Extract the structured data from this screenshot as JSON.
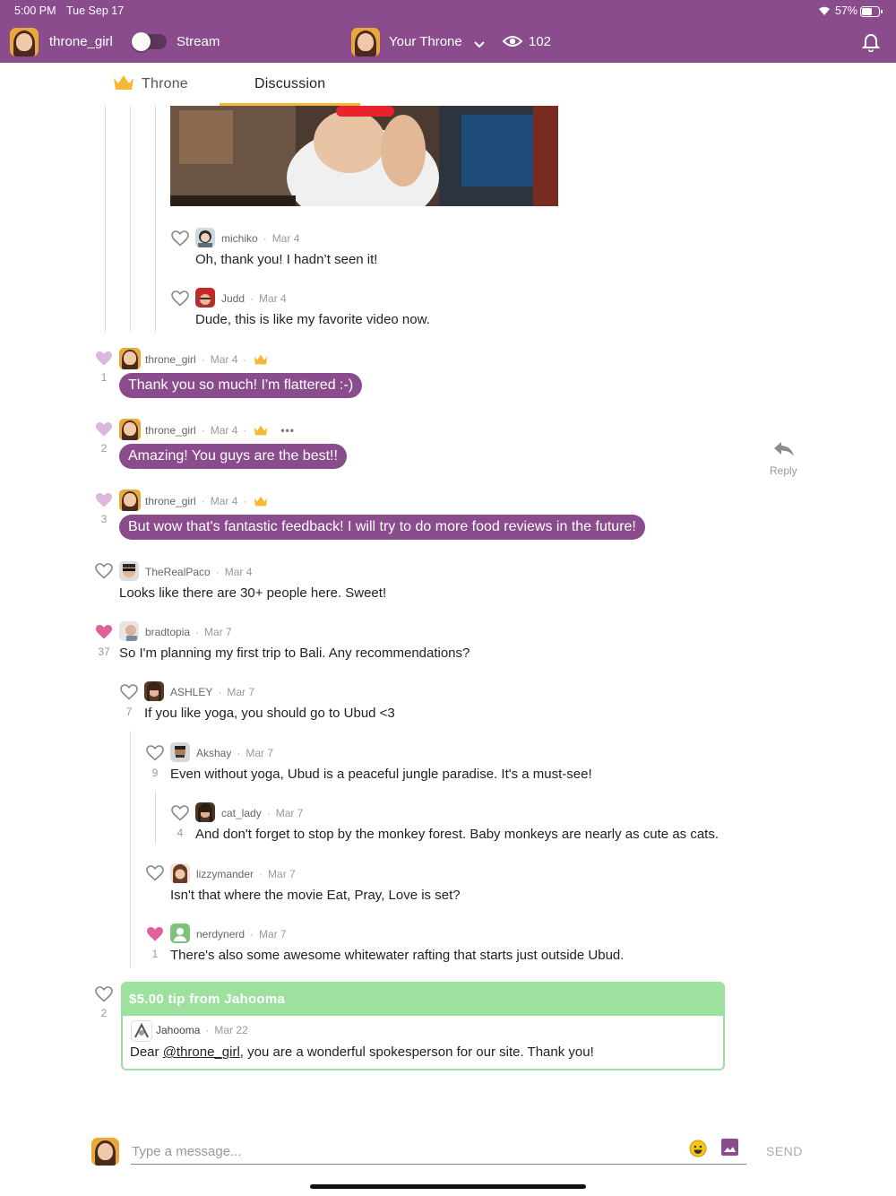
{
  "status_bar": {
    "time": "5:00 PM",
    "date": "Tue Sep 17",
    "battery": "57%"
  },
  "header": {
    "username": "throne_girl",
    "stream_label": "Stream",
    "throne_label": "Your Throne",
    "viewer_count": "102",
    "colors": {
      "bar": "#8a4c8c"
    }
  },
  "tabs": [
    {
      "label": "Throne"
    },
    {
      "label": "Discussion",
      "active": true
    }
  ],
  "comments": [
    {
      "user": "michiko",
      "date": "Mar 4",
      "text": "Oh, thank you! I hadn’t seen it!"
    },
    {
      "user": "Judd",
      "date": "Mar 4",
      "text": "Dude, this is like my favorite video now."
    },
    {
      "user": "throne_girl",
      "date": "Mar 4",
      "text": "Thank you so much! I'm flattered :-)",
      "likes": "1",
      "creator": true
    },
    {
      "user": "throne_girl",
      "date": "Mar 4",
      "text": "Amazing! You guys are the best!!",
      "likes": "2",
      "creator": true
    },
    {
      "user": "throne_girl",
      "date": "Mar 4",
      "text": "But wow that's fantastic feedback! I will try to do more food reviews in the future!",
      "likes": "3",
      "creator": true
    },
    {
      "user": "TheRealPaco",
      "date": "Mar 4",
      "text": "Looks like there are 30+ people here. Sweet!"
    },
    {
      "user": "bradtopia",
      "date": "Mar 7",
      "text": "So I'm planning my first trip to Bali. Any recommendations?",
      "likes": "37",
      "liked": true
    },
    {
      "user": "ASHLEY",
      "date": "Mar 7",
      "text": "If you like yoga, you should go to Ubud <3",
      "likes": "7"
    },
    {
      "user": "Akshay",
      "date": "Mar 7",
      "text": "Even without yoga, Ubud is a peaceful jungle paradise. It's a must-see!",
      "likes": "9"
    },
    {
      "user": "cat_lady",
      "date": "Mar 7",
      "text": "And don't forget to stop by the monkey forest. Baby monkeys are nearly as cute as cats.",
      "likes": "4"
    },
    {
      "user": "lizzymander",
      "date": "Mar 7",
      "text": "Isn't that where the movie Eat, Pray, Love is set?"
    },
    {
      "user": "nerdynerd",
      "date": "Mar 7",
      "text": "There's also some awesome whitewater rafting that starts just outside Ubud.",
      "likes": "1",
      "liked": true
    }
  ],
  "reply_label": "Reply",
  "tip": {
    "title": "$5.00 tip from Jahooma",
    "user": "Jahooma",
    "date": "Mar 22",
    "text_prefix": "Dear ",
    "mention": "@throne_girl",
    "text_suffix": ", you are a wonderful spokesperson for our site. Thank you!",
    "likes": "2"
  },
  "composer": {
    "placeholder": "Type a message...",
    "send_label": "SEND"
  },
  "colors": {
    "accent": "#f7b733",
    "bubble": "#8a4c8c",
    "heart_liked": "#e0609a",
    "heart_creator": "#d9b8d9",
    "tip_green": "#9ee09d"
  }
}
